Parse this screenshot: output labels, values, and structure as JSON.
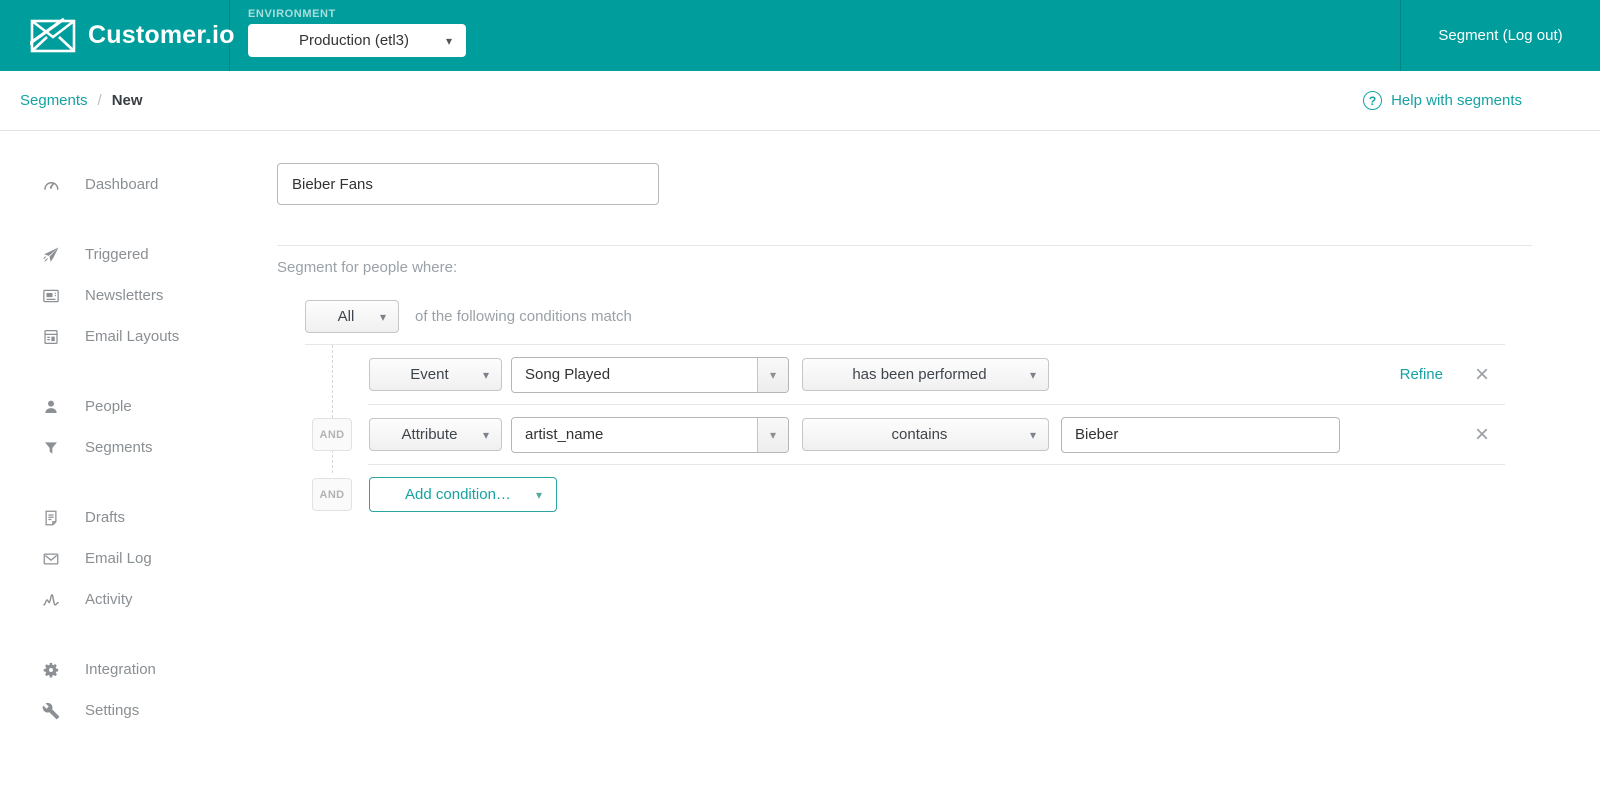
{
  "header": {
    "brand": "Customer.io",
    "environment_label": "ENVIRONMENT",
    "environment_value": "Production (etl3)",
    "account": "Segment (Log out)"
  },
  "breadcrumb": {
    "parent": "Segments",
    "separator": "/",
    "current": "New",
    "help_label": "Help with segments",
    "help_glyph": "?"
  },
  "sidebar": {
    "items": [
      {
        "label": "Dashboard",
        "icon": "gauge-icon"
      },
      {
        "label": "Triggered",
        "icon": "paper-plane-icon"
      },
      {
        "label": "Newsletters",
        "icon": "newspaper-icon"
      },
      {
        "label": "Email Layouts",
        "icon": "layout-icon"
      },
      {
        "label": "People",
        "icon": "person-icon"
      },
      {
        "label": "Segments",
        "icon": "funnel-icon"
      },
      {
        "label": "Drafts",
        "icon": "document-icon"
      },
      {
        "label": "Email Log",
        "icon": "envelope-icon"
      },
      {
        "label": "Activity",
        "icon": "activity-icon"
      },
      {
        "label": "Integration",
        "icon": "gear-icon"
      },
      {
        "label": "Settings",
        "icon": "wrench-icon"
      }
    ]
  },
  "main": {
    "segment_name": "Bieber Fans",
    "intro": "Segment for people where:",
    "match": {
      "selector_value": "All",
      "suffix": "of the following conditions match"
    },
    "conditions": [
      {
        "connector": "",
        "type": "Event",
        "subject": "Song Played",
        "operator": "has been performed",
        "refine_label": "Refine"
      },
      {
        "connector": "AND",
        "type": "Attribute",
        "subject": "artist_name",
        "operator": "contains",
        "value": "Bieber"
      }
    ],
    "add_condition": {
      "connector": "AND",
      "label": "Add condition…"
    }
  },
  "icons": {
    "caret": "▾",
    "close": "×"
  },
  "colors": {
    "header_teal": "#009d9d",
    "link_teal": "#16a2a2",
    "muted_gray": "#9aa1a7",
    "icon_gray": "#8c9094"
  }
}
